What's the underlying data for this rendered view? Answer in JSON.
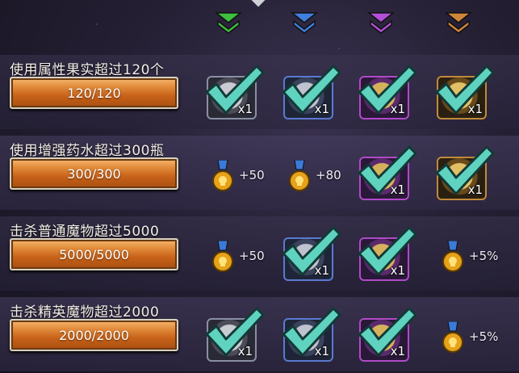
{
  "tiers": [
    {
      "name": "green-tier-marker",
      "color": "#3fbf3f"
    },
    {
      "name": "blue-tier-marker",
      "color": "#3f7fe0"
    },
    {
      "name": "purple-tier-marker",
      "color": "#b24fd8"
    },
    {
      "name": "orange-tier-marker",
      "color": "#d0863a"
    }
  ],
  "rows": [
    {
      "task": "使用属性果实超过120个",
      "progress_text": "120/120",
      "progress": 1.0,
      "rewards": [
        {
          "type": "item",
          "rarity": "gray",
          "qty": "x1",
          "claimed": true
        },
        {
          "type": "item",
          "rarity": "blue",
          "qty": "x1",
          "claimed": true
        },
        {
          "type": "item",
          "rarity": "purple",
          "qty": "x1",
          "claimed": true
        },
        {
          "type": "item",
          "rarity": "gold",
          "qty": "x1",
          "claimed": true
        }
      ]
    },
    {
      "task": "使用增强药水超过300瓶",
      "progress_text": "300/300",
      "progress": 1.0,
      "rewards": [
        {
          "type": "medal",
          "bonus": "+50",
          "claimed": false
        },
        {
          "type": "medal",
          "bonus": "+80",
          "claimed": false
        },
        {
          "type": "item",
          "rarity": "purple",
          "qty": "x1",
          "claimed": true
        },
        {
          "type": "item",
          "rarity": "gold",
          "qty": "x1",
          "claimed": true
        }
      ]
    },
    {
      "task": "击杀普通魔物超过5000",
      "progress_text": "5000/5000",
      "progress": 1.0,
      "rewards": [
        {
          "type": "medal",
          "bonus": "+50",
          "claimed": false
        },
        {
          "type": "item",
          "rarity": "blue",
          "qty": "x1",
          "claimed": true
        },
        {
          "type": "item",
          "rarity": "purple",
          "qty": "x1",
          "claimed": true
        },
        {
          "type": "medal",
          "bonus": "+5%",
          "claimed": false
        }
      ]
    },
    {
      "task": "击杀精英魔物超过2000",
      "progress_text": "2000/2000",
      "progress": 1.0,
      "rewards": [
        {
          "type": "item",
          "rarity": "gray",
          "qty": "x1",
          "claimed": true
        },
        {
          "type": "item",
          "rarity": "blue",
          "qty": "x1",
          "claimed": true
        },
        {
          "type": "item",
          "rarity": "purple",
          "qty": "x1",
          "claimed": true
        },
        {
          "type": "medal",
          "bonus": "+5%",
          "claimed": false
        }
      ]
    }
  ],
  "check_color": "#5fd2c0",
  "medal_icon": "skull-medal-icon",
  "check_icon": "checkmark-icon"
}
